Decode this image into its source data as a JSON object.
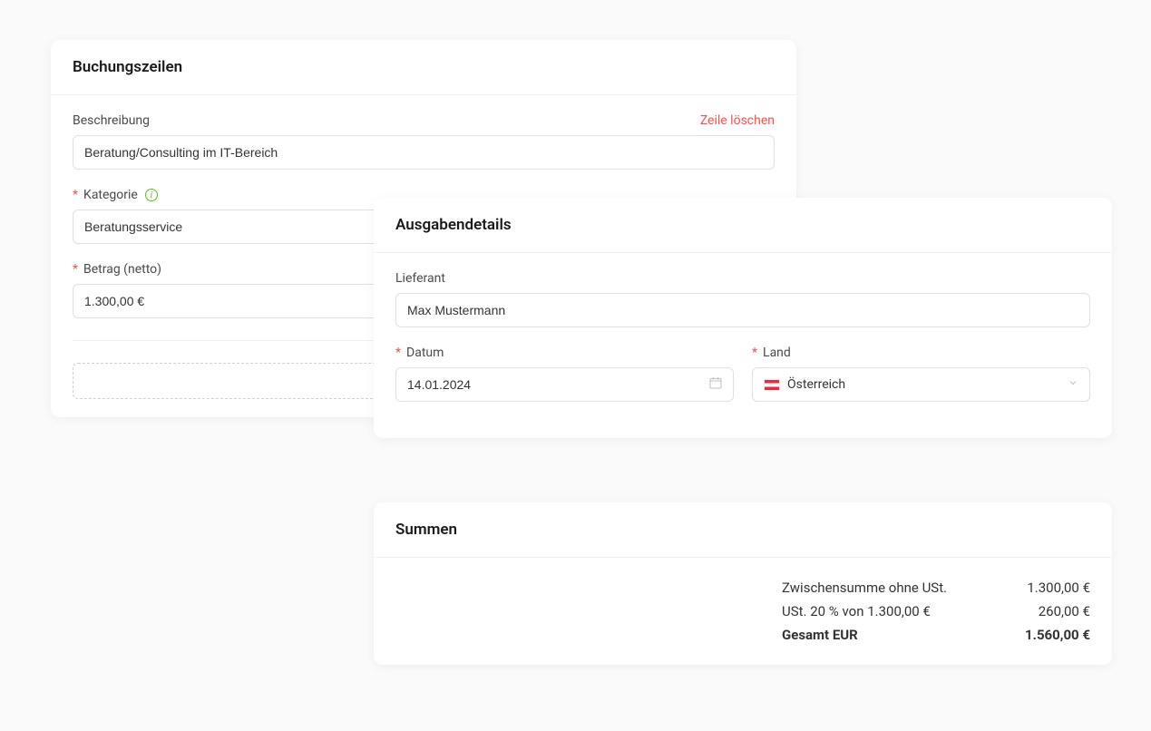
{
  "booking": {
    "title": "Buchungszeilen",
    "description_label": "Beschreibung",
    "delete_label": "Zeile löschen",
    "description_value": "Beratung/Consulting im IT-Bereich",
    "category_label": "Kategorie",
    "category_value": "Beratungsservice",
    "amount_label": "Betrag (netto)",
    "amount_value": "1.300,00 €",
    "add_line_label": "+"
  },
  "details": {
    "title": "Ausgabendetails",
    "supplier_label": "Lieferant",
    "supplier_value": "Max Mustermann",
    "date_label": "Datum",
    "date_value": "14.01.2024",
    "country_label": "Land",
    "country_value": "Österreich"
  },
  "totals": {
    "title": "Summen",
    "subtotal_label": "Zwischensumme ohne USt.",
    "subtotal_value": "1.300,00 €",
    "vat_label": "USt. 20 % von 1.300,00 €",
    "vat_value": "260,00 €",
    "total_label": "Gesamt EUR",
    "total_value": "1.560,00 €"
  }
}
